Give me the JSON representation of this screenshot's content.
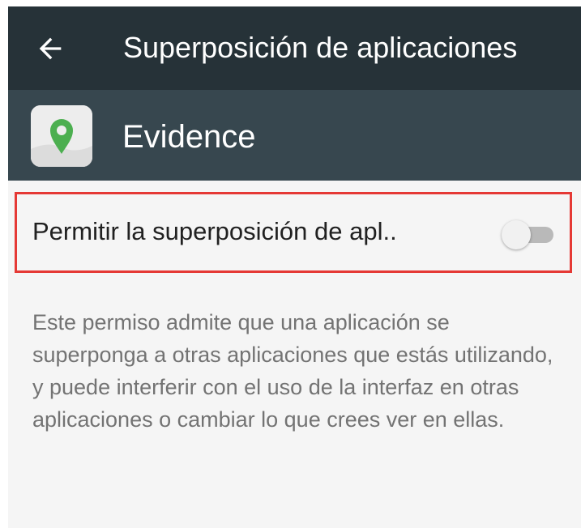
{
  "toolbar": {
    "title": "Superposición de aplicaciones",
    "back_icon": "arrow-back-icon"
  },
  "app": {
    "name": "Evidence",
    "icon": "map-pin-icon",
    "icon_color": "#4caf50"
  },
  "setting": {
    "label": "Permitir la superposición de apl..",
    "enabled": false
  },
  "description": "Este permiso admite que una aplicación se superponga a otras aplicaciones que estás utilizando, y puede interferir con el uso de la interfaz en otras aplicaciones o cambiar lo que crees ver en ellas.",
  "colors": {
    "toolbar": "#263238",
    "app_header": "#37474f",
    "highlight_border": "#e53935"
  }
}
